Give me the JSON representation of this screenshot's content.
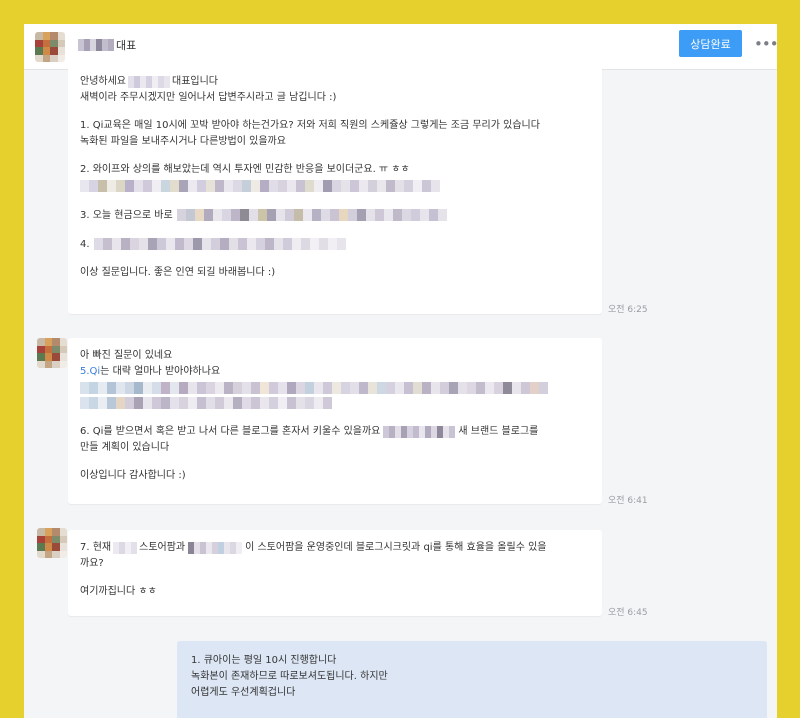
{
  "header": {
    "name_suffix": "대표",
    "done_button": "상담완료",
    "more_icon": "•••"
  },
  "messages": [
    {
      "lines": [
        "안녕하세요",
        "대표입니다",
        "새벽이라 주무시겠지만 일어나서 답변주시라고 글 남깁니다 :)",
        "1. Qi교육은 매일 10시에 꼬박 받아야 하는건가요? 저와 저희 직원의 스케쥴상 그렇게는 조금 무리가 있습니다",
        "녹화된 파일을 보내주시거나 다른방법이 있을까요",
        "2. 와이프와 상의를 해보았는데 역시 투자엔 민감한 반응을 보이더군요. ㅠ ㅎㅎ",
        "3. 오늘 현금으로 바로",
        "4.",
        "이상 질문입니다. 좋은 인연 되길 바래봅니다 :)"
      ],
      "time": "오전 6:25"
    },
    {
      "lines": [
        "아 빠진 질문이 있네요",
        "5.Qi",
        "는 대략 얼마나 받아야하나요",
        "6. Qi를 받으면서 혹은 받고 나서 다른 블로그를 혼자서 키울수 있을까요",
        "새 브랜드 블로그를",
        "만들 계획이 있습니다",
        "이상입니다 감사합니다 :)"
      ],
      "time": "오전 6:41"
    },
    {
      "lines": [
        "7. 현재",
        "스토어팜과",
        "이 스토어팜을 운영중인데 블로그시크릿과 qi를 통해 효율을 올릴수 있을",
        "까요?",
        "여기까집니다 ㅎㅎ"
      ],
      "time": "오전 6:45"
    }
  ],
  "reply": {
    "lines": [
      "1. 큐아이는 평일 10시 진행합니다",
      "녹화본이 존재하므로 따로보셔도됩니다. 하지만",
      "어렵게도 우선계획겁니다"
    ]
  },
  "colors": {
    "frame_border": "#e5d02e",
    "accent": "#3d9cf5",
    "link": "#3d7fd6",
    "my_bubble": "#dce6f4"
  }
}
